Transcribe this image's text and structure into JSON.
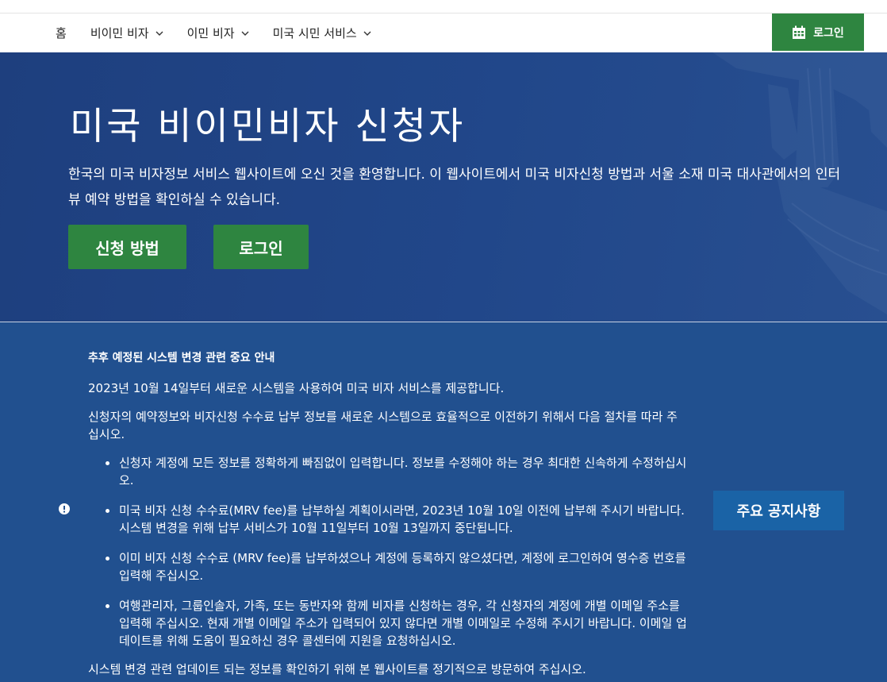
{
  "nav": {
    "items": [
      {
        "label": "홈",
        "has_dropdown": false
      },
      {
        "label": "비이민 비자",
        "has_dropdown": true
      },
      {
        "label": "이민 비자",
        "has_dropdown": true
      },
      {
        "label": "미국 시민 서비스",
        "has_dropdown": true
      }
    ],
    "login_label": "로그인",
    "login_icon": "calendar-icon"
  },
  "hero": {
    "title": "미국 비이민비자 신청자",
    "text": "한국의 미국 비자정보 서비스 웹사이트에 오신 것을 환영합니다. 이 웹사이트에서 미국 비자신청 방법과 서울 소재 미국 대사관에서의 인터뷰 예약 방법을 확인하실 수 있습니다.",
    "apply_button": "신청 방법",
    "login_button": "로그인"
  },
  "notice": {
    "heading": "추후 예정된 시스템 변경 관련 중요 안내",
    "p1": "2023년 10월 14일부터 새로운 시스템을 사용하여 미국 비자 서비스를 제공합니다.",
    "p2": "신청자의 예약정보와 비자신청 수수료 납부 정보를 새로운 시스템으로 효율적으로 이전하기 위해서 다음 절차를 따라 주십시오.",
    "bullets": [
      "신청자 계정에 모든 정보를 정확하게 빠짐없이 입력합니다. 정보를 수정해야 하는 경우 최대한 신속하게 수정하십시오.",
      "미국 비자 신청 수수료(MRV fee)를 납부하실 계획이시라면, 2023년 10월 10일 이전에 납부해 주시기 바랍니다. 시스템 변경을 위해 납부 서비스가 10월 11일부터 10월 13일까지 중단됩니다.",
      "이미 비자 신청 수수료 (MRV fee)를 납부하셨으나 계정에 등록하지 않으셨다면, 계정에 로그인하여 영수증 번호를 입력해 주십시오.",
      "여행관리자, 그룹인솔자, 가족, 또는 동반자와 함께 비자를 신청하는 경우, 각 신청자의 계정에 개별 이메일 주소를 입력해 주십시오. 현재 개별 이메일 주소가 입력되어 있지 않다면 개별 이메일로 수정해 주시기 바랍니다. 이메일 업데이트를 위해 도움이 필요하신 경우 콜센터에 지원을 요청하십시오."
    ],
    "p3": "시스템 변경 관련 업데이트 되는 정보를 확인하기 위해 본 웹사이트를 정기적으로 방문하여 주십시오.",
    "button_label": "주요 공지사항",
    "alert_icon": "alert-icon"
  },
  "colors": {
    "green": "#2e8540",
    "hero_blue": "#21478a",
    "notice_blue": "#21508f",
    "notice_button_blue": "#1a63a6"
  }
}
